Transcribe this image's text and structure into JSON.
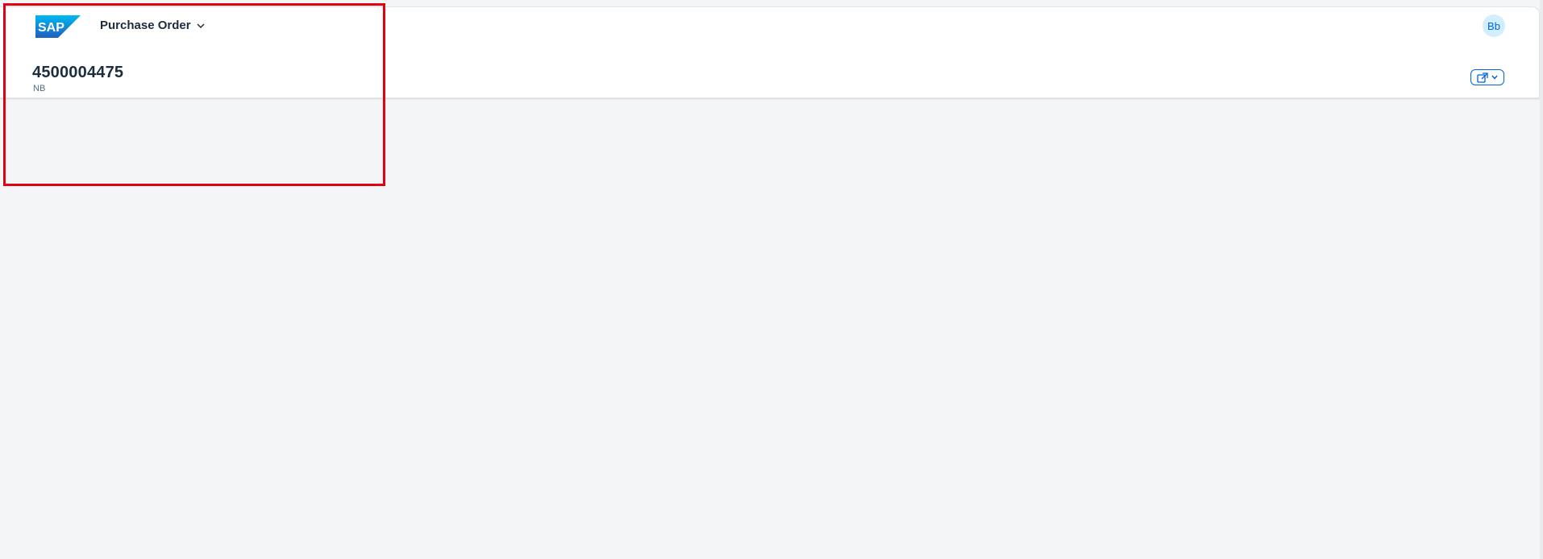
{
  "shell": {
    "logo_text": "SAP",
    "app_title": "Purchase Order",
    "user_initials": "Bb"
  },
  "object_header": {
    "title": "4500004475",
    "subtitle": "NB"
  },
  "icons": {
    "logo": "sap-logo",
    "app_menu": "chevron-down-icon",
    "share": "share-icon"
  },
  "colors": {
    "page_background": "#f4f5f7",
    "card_background": "#ffffff",
    "brand_blue": "#0064d9",
    "text_primary": "#1d2d3e",
    "text_secondary": "#556b82",
    "avatar_background": "#d1efff",
    "highlight": "#e3000f"
  }
}
